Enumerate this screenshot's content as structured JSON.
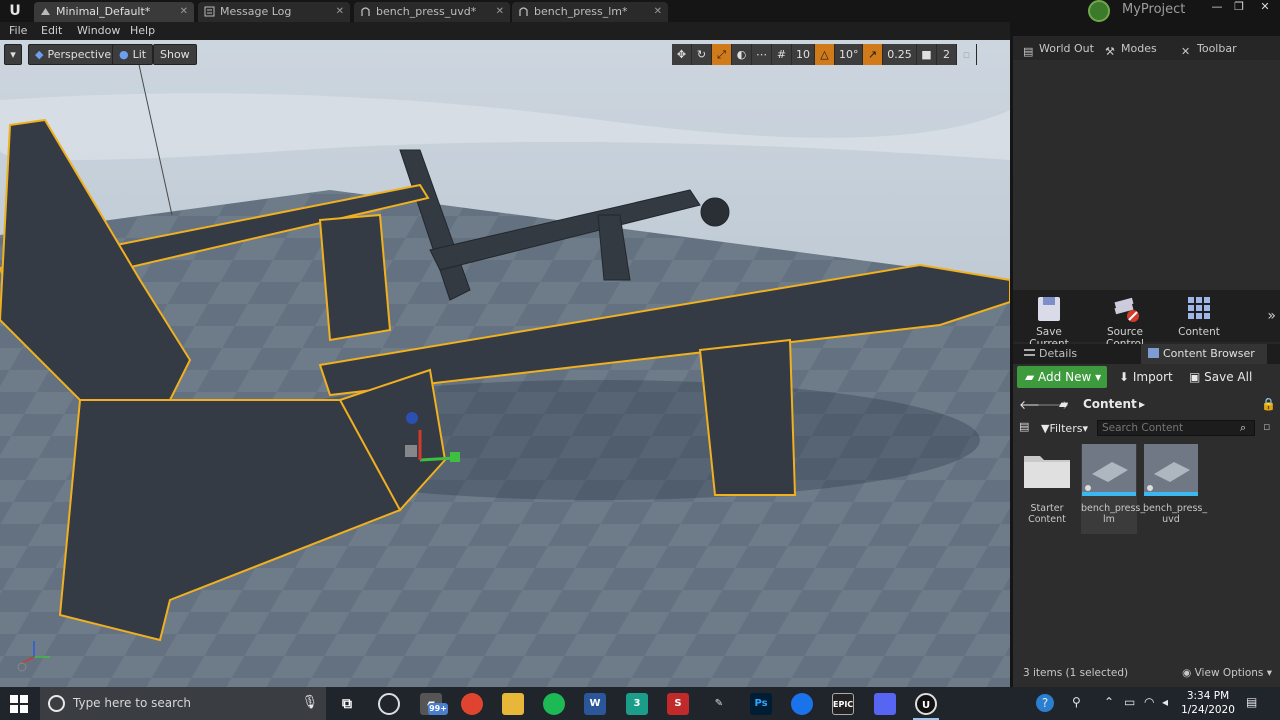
{
  "titlebar": {
    "tabs": [
      {
        "label": "Minimal_Default*",
        "active": true
      },
      {
        "label": "Message Log",
        "active": false
      },
      {
        "label": "bench_press_uvd*",
        "active": false
      },
      {
        "label": "bench_press_lm*",
        "active": false
      }
    ],
    "project": "MyProject",
    "window_controls": [
      "—",
      "❐",
      "✕"
    ]
  },
  "menubar": [
    "File",
    "Edit",
    "Window",
    "Help"
  ],
  "viewport": {
    "perspective": "Perspective",
    "lit": "Lit",
    "show": "Show",
    "grid_snap": "10",
    "rot_snap": "10°",
    "scale_snap": "0.25",
    "cam_speed": "2"
  },
  "right_panel": {
    "tabs": [
      "World Out",
      "Modes",
      "Toolbar"
    ],
    "tools": [
      "Save Current",
      "Source Control",
      "Content"
    ],
    "lower_tabs": [
      "Details",
      "Content Browser"
    ],
    "content_browser": {
      "add_new": "Add New",
      "import": "Import",
      "save_all": "Save All",
      "path": "Content",
      "filters": "Filters",
      "search_placeholder": "Search Content",
      "assets": [
        {
          "line1": "Starter",
          "line2": "Content",
          "kind": "folder",
          "selected": false
        },
        {
          "line1": "bench_press_",
          "line2": "lm",
          "kind": "mesh",
          "selected": true
        },
        {
          "line1": "bench_press_",
          "line2": "uvd",
          "kind": "mesh",
          "selected": false
        }
      ],
      "status": "3 items (1 selected)",
      "view_options": "View Options"
    }
  },
  "taskbar": {
    "search_placeholder": "Type here to search",
    "badge": "99+",
    "time": "3:34 PM",
    "date": "1/24/2020"
  },
  "colors": {
    "selection_outline": "#f0b020",
    "add_new_green": "#3d9a3d",
    "accent_orange": "#d17a1a"
  }
}
